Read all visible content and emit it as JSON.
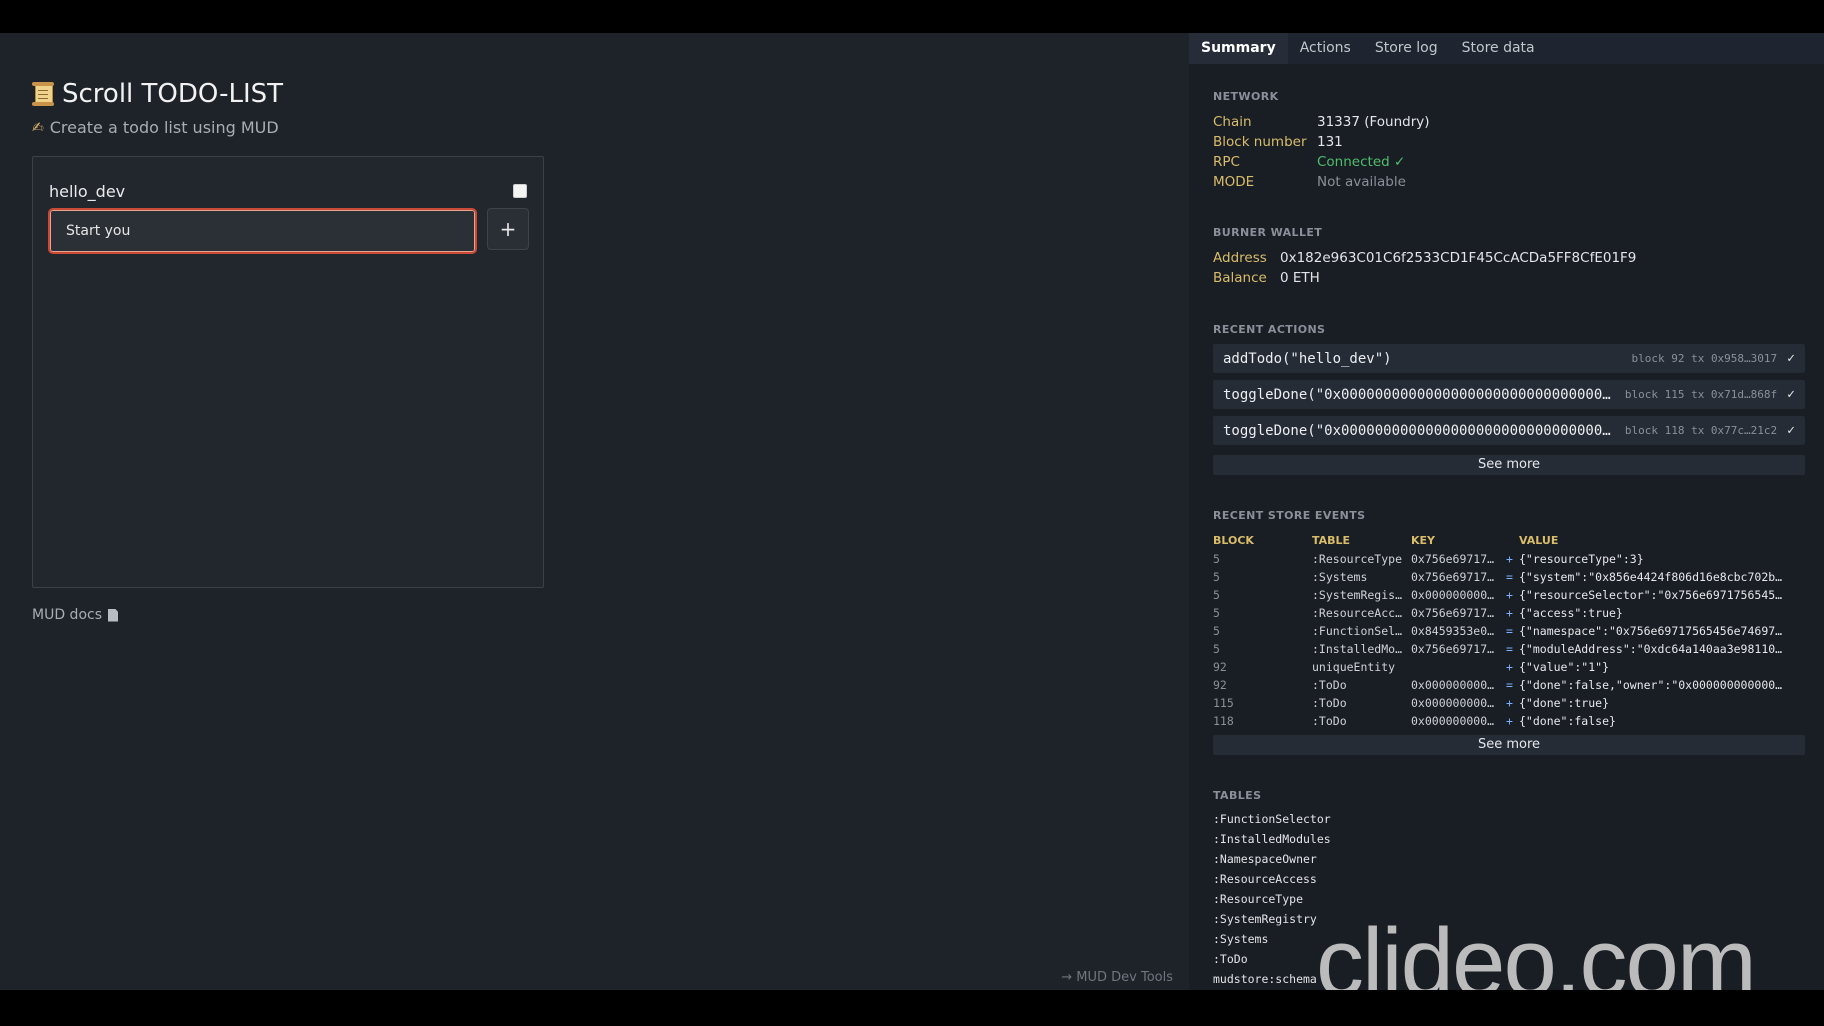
{
  "app": {
    "title": "Scroll TODO-LIST",
    "subtitle": "Create a todo list using MUD",
    "todo_title": "hello_dev",
    "input_value": "Start you",
    "add_label": "+",
    "docs_link": "MUD docs",
    "devtools_link": "→ MUD Dev Tools"
  },
  "tabs": [
    "Summary",
    "Actions",
    "Store log",
    "Store data"
  ],
  "network": {
    "heading": "NETWORK",
    "chain_label": "Chain",
    "chain": "31337 (Foundry)",
    "block_label": "Block number",
    "block": "131",
    "rpc_label": "RPC",
    "rpc": "Connected ✓",
    "mode_label": "MODE",
    "mode": "Not available"
  },
  "wallet": {
    "heading": "BURNER WALLET",
    "address_label": "Address",
    "address": "0x182e963C01C6f2533CD1F45CcACDa5FF8CfE01F9",
    "balance_label": "Balance",
    "balance": "0 ETH"
  },
  "recent_actions": {
    "heading": "RECENT ACTIONS",
    "items": [
      {
        "call": "addTodo(\"hello_dev\")",
        "meta": "block 92 tx 0x958…3017",
        "status": "✓"
      },
      {
        "call": "toggleDone(\"0x000000000000000000000000000000000000000000000000000000000000\")",
        "meta": "block 115 tx 0x71d…868f",
        "status": "✓"
      },
      {
        "call": "toggleDone(\"0x000000000000000000000000000000000000000000000000000000000000\")",
        "meta": "block 118 tx 0x77c…21c2",
        "status": "✓"
      }
    ],
    "see_more": "See more"
  },
  "store_events": {
    "heading": "RECENT STORE EVENTS",
    "columns": [
      "BLOCK",
      "TABLE",
      "KEY",
      "VALUE"
    ],
    "rows": [
      {
        "block": "5",
        "table": ":ResourceType",
        "key": "0x756e69717…",
        "op": "+",
        "value": "{\"resourceType\":3}"
      },
      {
        "block": "5",
        "table": ":Systems",
        "key": "0x756e69717…",
        "op": "=",
        "value": "{\"system\":\"0x856e4424f806d16e8cbc702b…"
      },
      {
        "block": "5",
        "table": ":SystemRegistry",
        "key": "0x000000000…",
        "op": "+",
        "value": "{\"resourceSelector\":\"0x756e6971756545…"
      },
      {
        "block": "5",
        "table": ":ResourceAccess",
        "key": "0x756e69717…",
        "op": "+",
        "value": "{\"access\":true}"
      },
      {
        "block": "5",
        "table": ":FunctionSelector",
        "key": "0x8459353e0…",
        "op": "=",
        "value": "{\"namespace\":\"0x756e69717565456e74697…"
      },
      {
        "block": "5",
        "table": ":InstalledModules",
        "key": "0x756e69717…",
        "op": "=",
        "value": "{\"moduleAddress\":\"0xdc64a140aa3e98110…"
      },
      {
        "block": "92",
        "table": "uniqueEntity",
        "key": "",
        "op": "+",
        "value": "{\"value\":\"1\"}"
      },
      {
        "block": "92",
        "table": ":ToDo",
        "key": "0x000000000…",
        "op": "=",
        "value": "{\"done\":false,\"owner\":\"0x000000000000…"
      },
      {
        "block": "115",
        "table": ":ToDo",
        "key": "0x000000000…",
        "op": "+",
        "value": "{\"done\":true}"
      },
      {
        "block": "118",
        "table": ":ToDo",
        "key": "0x000000000…",
        "op": "+",
        "value": "{\"done\":false}"
      }
    ],
    "see_more": "See more"
  },
  "tables": {
    "heading": "TABLES",
    "items": [
      ":FunctionSelector",
      ":InstalledModules",
      ":NamespaceOwner",
      ":ResourceAccess",
      ":ResourceType",
      ":SystemRegistry",
      ":Systems",
      ":ToDo",
      "mudstore:schema"
    ]
  },
  "watermark": "clideo.com"
}
